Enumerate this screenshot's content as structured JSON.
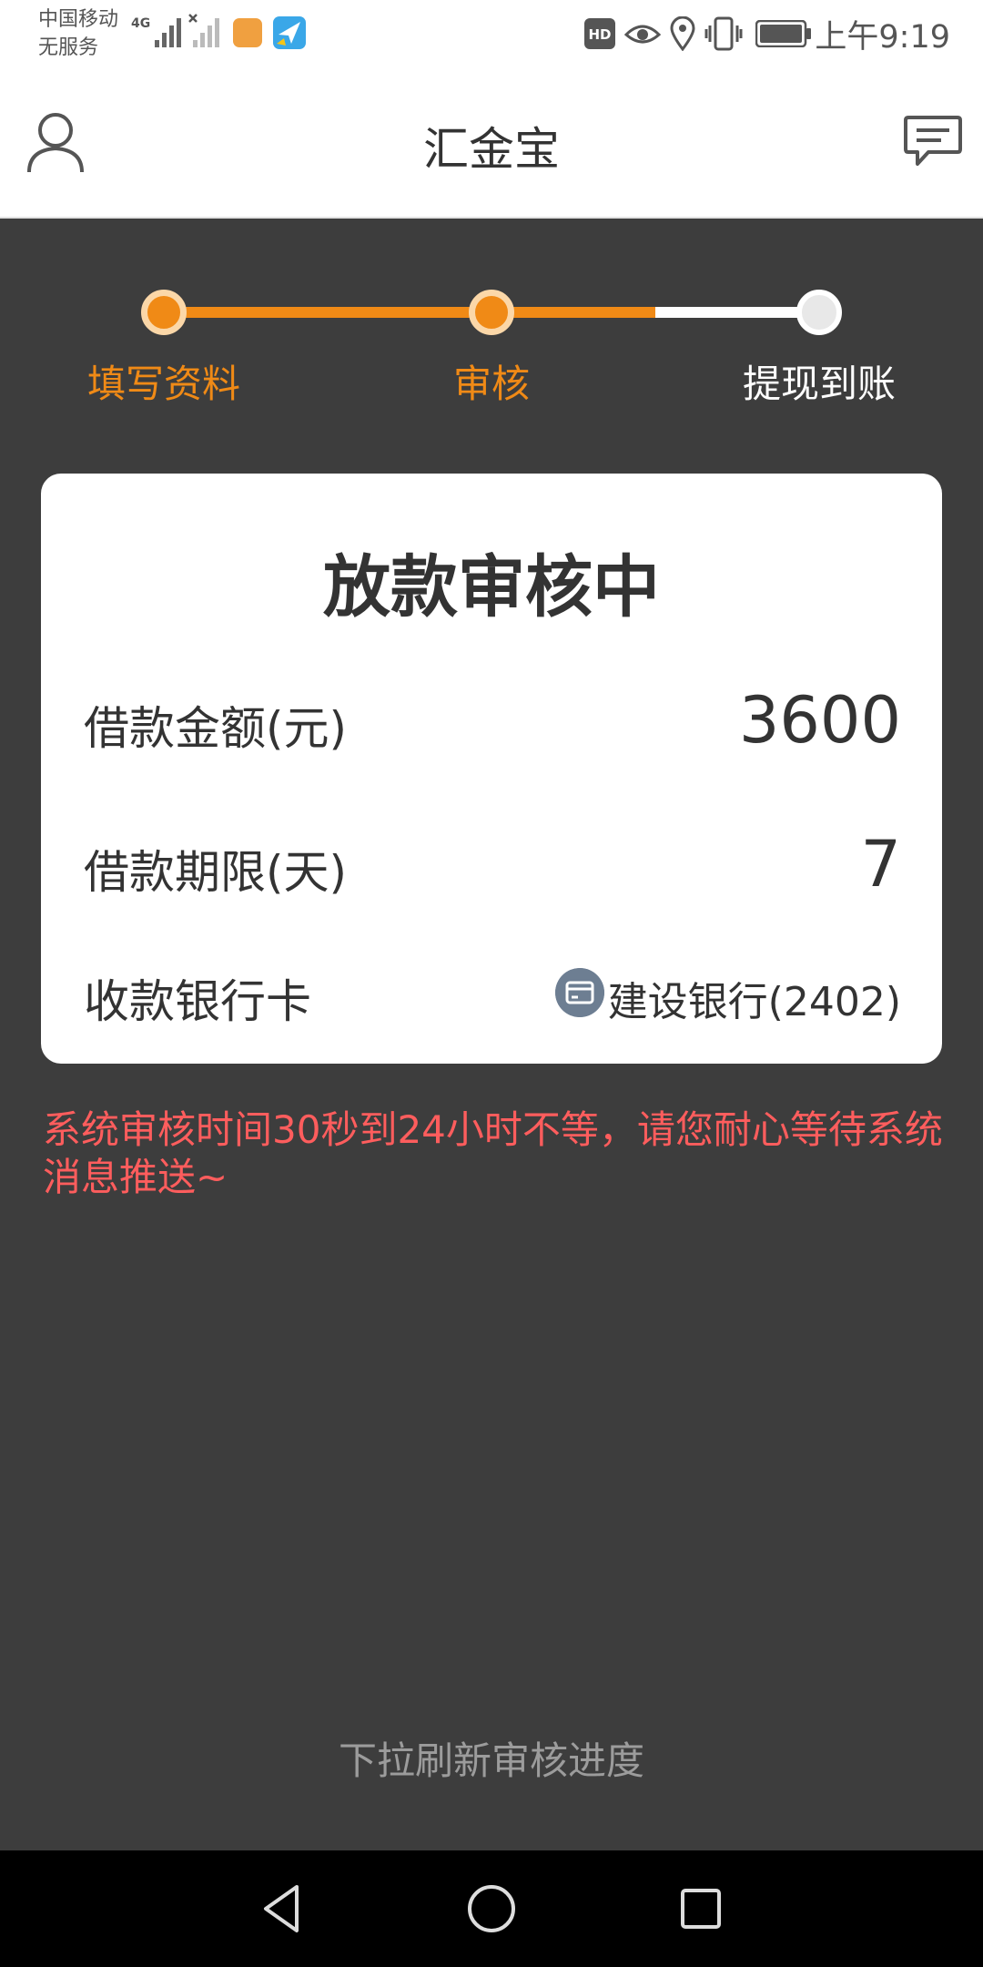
{
  "status_bar": {
    "carrier_line1": "中国移动",
    "carrier_line2": "无服务",
    "network": "4G",
    "time": "上午9:19",
    "icons": [
      "signal-icon",
      "no-signal-icon",
      "app-notification-icon",
      "navigation-app-icon",
      "hd-icon",
      "eye-icon",
      "location-icon",
      "vibrate-icon",
      "battery-icon"
    ]
  },
  "app_bar": {
    "title": "汇金宝",
    "left_icon": "user-icon",
    "right_icon": "message-icon"
  },
  "progress": {
    "steps": [
      {
        "label": "填写资料",
        "state": "done"
      },
      {
        "label": "审核",
        "state": "current"
      },
      {
        "label": "提现到账",
        "state": "pending"
      }
    ],
    "filled_fraction": 0.6
  },
  "card": {
    "title": "放款审核中",
    "amount_label": "借款金额(元)",
    "amount_value": "3600",
    "term_label": "借款期限(天)",
    "term_value": "7",
    "bank_label": "收款银行卡",
    "bank_value": "建设银行(2402)"
  },
  "notice": "系统审核时间30秒到24小时不等，请您耐心等待系统消息推送~",
  "refresh_tip": "下拉刷新审核进度",
  "colors": {
    "accent": "#f08a16",
    "notice": "#ff5d5d",
    "background": "#3d3d3d"
  }
}
